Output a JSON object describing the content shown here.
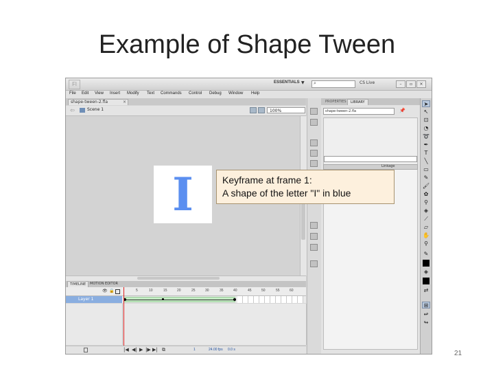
{
  "slide": {
    "title": "Example of Shape Tween",
    "number": "21"
  },
  "app": {
    "logo": "Fl",
    "workspace_label": "ESSENTIALS",
    "workspace_arrow": "▼",
    "search_icon": "search-icon",
    "cs_live_label": "CS Live",
    "window_buttons": [
      "minimize",
      "restore",
      "close"
    ]
  },
  "menu": {
    "items": [
      "File",
      "Edit",
      "View",
      "Insert",
      "Modify",
      "Text",
      "Commands",
      "Control",
      "Debug",
      "Window",
      "Help"
    ]
  },
  "document": {
    "tab_label": "shape-tween-2.fla",
    "tab_close": "×",
    "scene_label": "Scene 1",
    "zoom": "100%"
  },
  "stage": {
    "shape_letter": "I",
    "shape_color": "#5b8ff0"
  },
  "callout": {
    "line1": "Keyframe at frame 1:",
    "line2": "A shape of the letter \"I\" in blue"
  },
  "timeline": {
    "tabs": [
      "TIMELINE",
      "MOTION EDITOR"
    ],
    "layer_name": "Layer 1",
    "frame_numbers": [
      "5",
      "10",
      "15",
      "20",
      "25",
      "30",
      "35",
      "40",
      "45",
      "50",
      "55",
      "60"
    ],
    "current_frame": "1",
    "fps": "24.00 fps",
    "elapsed": "0.0 s",
    "tween_color": "#c4ecc4",
    "selection_color": "#8aaee0"
  },
  "library": {
    "tabs": [
      "PROPERTIES",
      "LIBRARY"
    ],
    "document": "shape-tween-2.fla",
    "column_linkage": "Linkage"
  },
  "tools": {
    "stroke_color": "#000000",
    "fill_color": "#000000"
  }
}
